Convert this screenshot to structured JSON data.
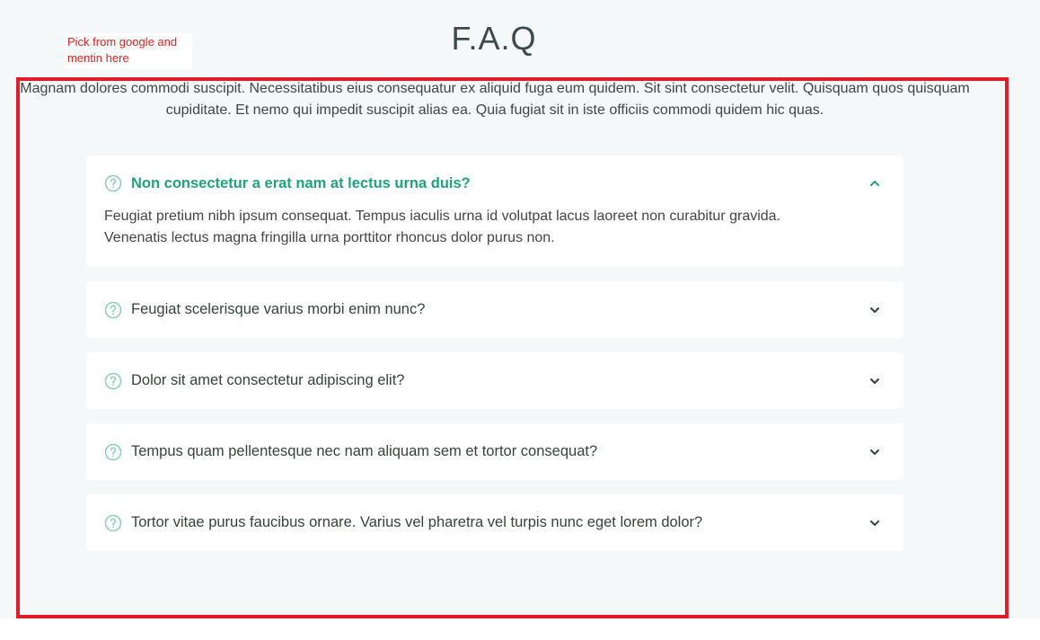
{
  "page": {
    "title": "F.A.Q",
    "note": "Pick from google and mentin here",
    "intro": "Magnam dolores commodi suscipit. Necessitatibus eius consequatur ex aliquid fuga eum quidem. Sit sint consectetur velit. Quisquam quos quisquam cupiditate. Et nemo qui impedit suscipit alias ea. Quia fugiat sit in iste officiis commodi quidem hic quas."
  },
  "colors": {
    "accent": "#1fa37a",
    "annotation_red": "#e11d2c",
    "icon_teal": "#8fcfbd"
  },
  "faq": {
    "items": [
      {
        "question": "Non consectetur a erat nam at lectus urna duis?",
        "answer": "Feugiat pretium nibh ipsum consequat. Tempus iaculis urna id volutpat lacus laoreet non curabitur gravida. Venenatis lectus magna fringilla urna porttitor rhoncus dolor purus non.",
        "open": true,
        "icon": "question-circle-icon",
        "toggle_icon": "chevron-up-icon"
      },
      {
        "question": "Feugiat scelerisque varius morbi enim nunc?",
        "open": false,
        "icon": "question-circle-icon",
        "toggle_icon": "chevron-down-icon"
      },
      {
        "question": "Dolor sit amet consectetur adipiscing elit?",
        "open": false,
        "icon": "question-circle-icon",
        "toggle_icon": "chevron-down-icon"
      },
      {
        "question": "Tempus quam pellentesque nec nam aliquam sem et tortor consequat?",
        "open": false,
        "icon": "question-circle-icon",
        "toggle_icon": "chevron-down-icon"
      },
      {
        "question": "Tortor vitae purus faucibus ornare. Varius vel pharetra vel turpis nunc eget lorem dolor?",
        "open": false,
        "icon": "question-circle-icon",
        "toggle_icon": "chevron-down-icon"
      }
    ]
  }
}
